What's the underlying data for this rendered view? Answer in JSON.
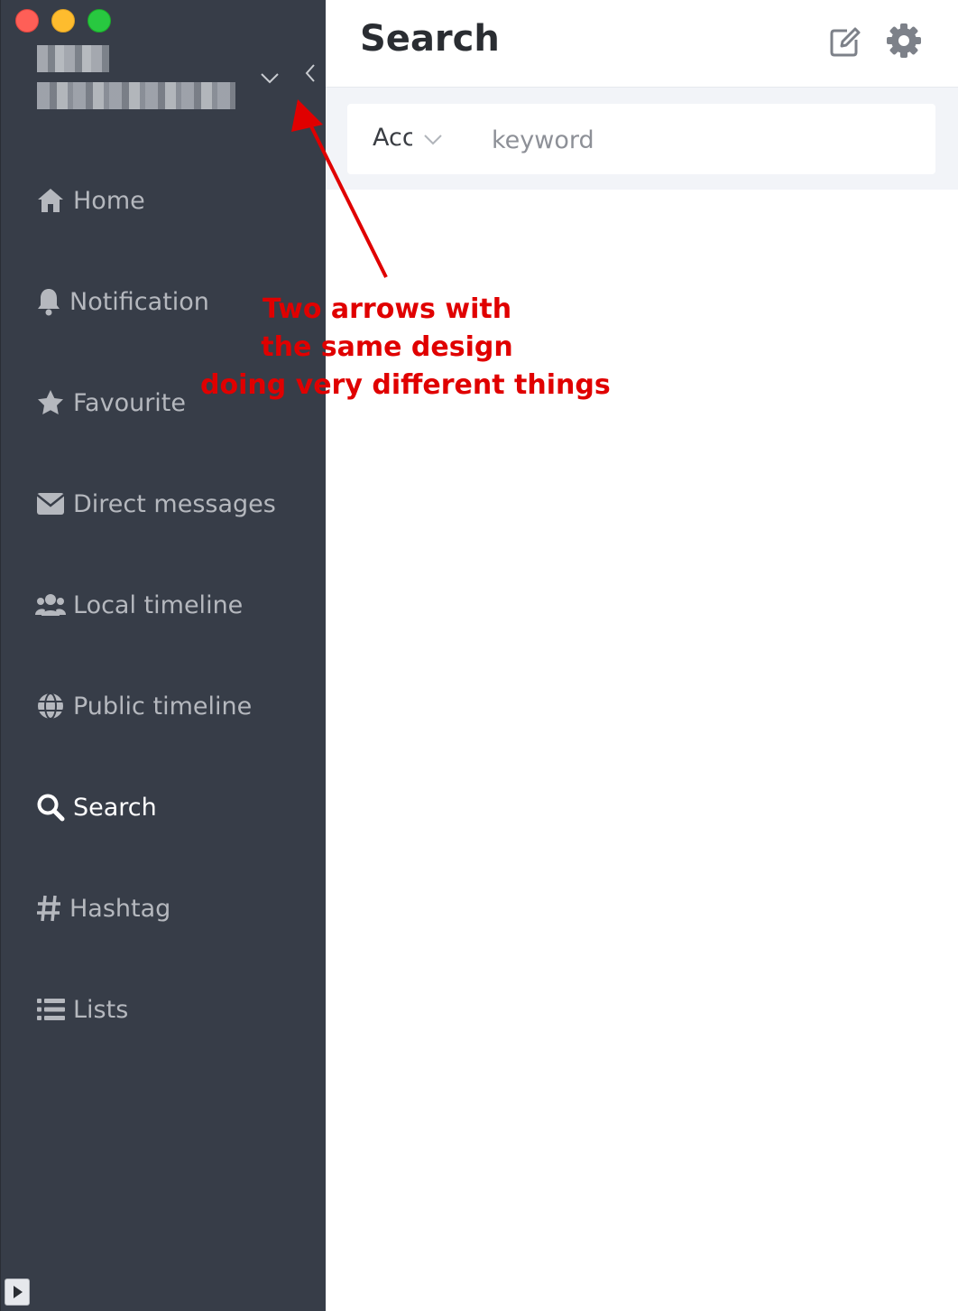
{
  "sidebar": {
    "menu": [
      {
        "label": "Home",
        "icon": "home-icon"
      },
      {
        "label": "Notification",
        "icon": "bell-icon"
      },
      {
        "label": "Favourite",
        "icon": "star-icon"
      },
      {
        "label": "Direct messages",
        "icon": "envelope-icon"
      },
      {
        "label": "Local timeline",
        "icon": "users-icon"
      },
      {
        "label": "Public timeline",
        "icon": "globe-icon"
      },
      {
        "label": "Search",
        "icon": "search-icon",
        "active": true
      },
      {
        "label": "Hashtag",
        "icon": "hashtag-icon"
      },
      {
        "label": "Lists",
        "icon": "list-icon"
      }
    ]
  },
  "header": {
    "title": "Search"
  },
  "search": {
    "type_value": "Account",
    "placeholder": "keyword"
  },
  "annotation": {
    "lines": [
      "Two arrows with",
      "the same design",
      "doing very different things"
    ],
    "color": "#e00000"
  },
  "colors": {
    "sidebar_bg": "#373d48",
    "menu_text": "#b5b8be",
    "active_text": "#ffffff",
    "search_area_bg": "#f2f4f8"
  }
}
